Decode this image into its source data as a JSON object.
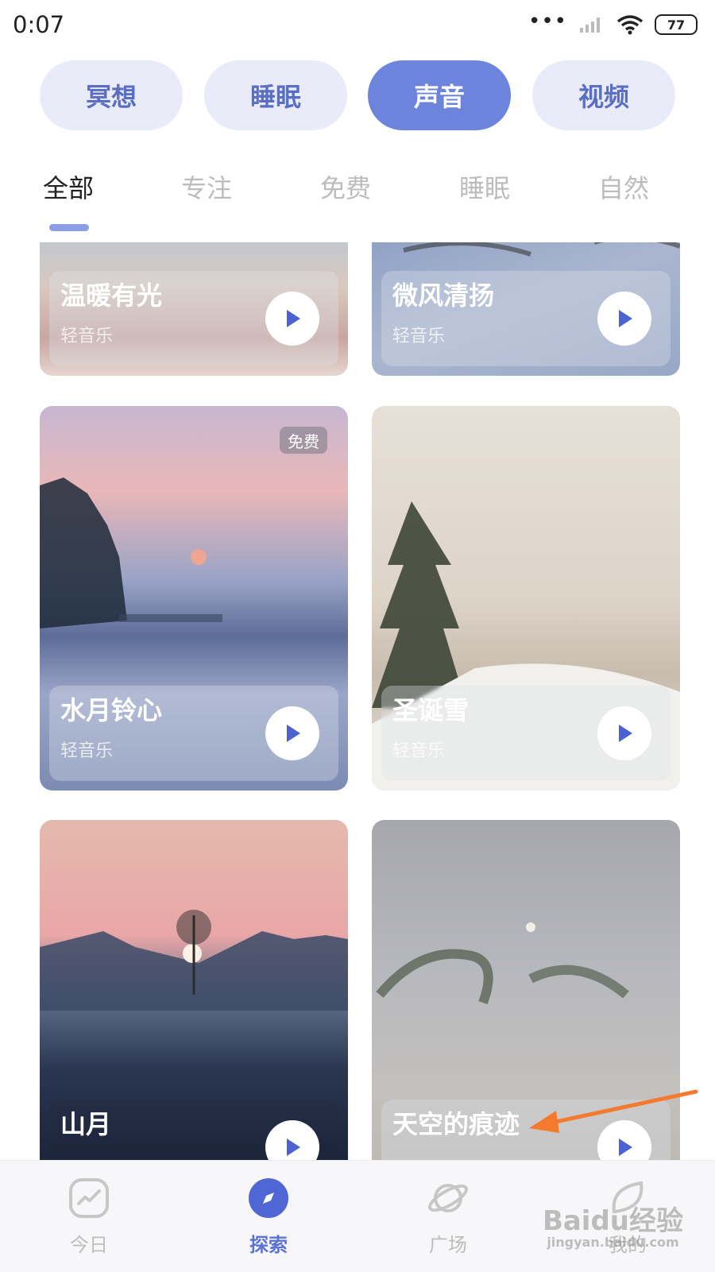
{
  "status_bar": {
    "time": "0:07",
    "battery": "77",
    "icons": [
      "more-dots-icon",
      "signal-icon",
      "wifi-icon",
      "battery-icon"
    ]
  },
  "categories": [
    {
      "label": "冥想",
      "active": false
    },
    {
      "label": "睡眠",
      "active": false
    },
    {
      "label": "声音",
      "active": true
    },
    {
      "label": "视频",
      "active": false
    }
  ],
  "tabs": [
    {
      "label": "全部",
      "active": true
    },
    {
      "label": "专注",
      "active": false
    },
    {
      "label": "免费",
      "active": false
    },
    {
      "label": "睡眠",
      "active": false
    },
    {
      "label": "自然",
      "active": false
    }
  ],
  "cards": [
    {
      "title": "温暖有光",
      "subtitle": "轻音乐",
      "badge": ""
    },
    {
      "title": "微风清扬",
      "subtitle": "轻音乐",
      "badge": ""
    },
    {
      "title": "水月铃心",
      "subtitle": "轻音乐",
      "badge": "免费"
    },
    {
      "title": "圣诞雪",
      "subtitle": "轻音乐",
      "badge": ""
    },
    {
      "title": "山月",
      "subtitle": "",
      "badge": ""
    },
    {
      "title": "天空的痕迹",
      "subtitle": "",
      "badge": ""
    }
  ],
  "bottom_nav": [
    {
      "label": "今日",
      "icon": "trend-chart-icon",
      "active": false
    },
    {
      "label": "探索",
      "icon": "compass-icon",
      "active": true
    },
    {
      "label": "广场",
      "icon": "planet-icon",
      "active": false
    },
    {
      "label": "我的",
      "icon": "leaf-profile-icon",
      "active": false
    }
  ],
  "watermark": {
    "text": "Baidu经验",
    "sub": "jingyan.baidu.com"
  },
  "colors": {
    "accent": "#6d84dc",
    "pill_bg": "#e9ecf8",
    "pill_text": "#5a6fc4",
    "annotation_arrow": "#f47a2e"
  }
}
